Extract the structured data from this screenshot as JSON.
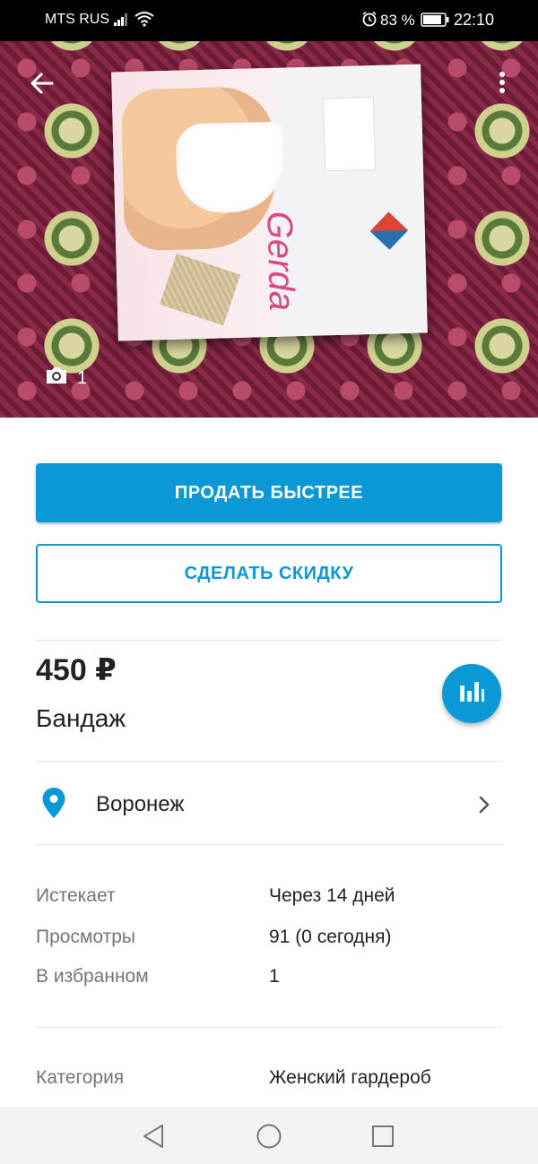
{
  "status_bar": {
    "carrier": "MTS RUS",
    "battery_percent": "83 %",
    "time": "22:10"
  },
  "photo": {
    "count": "1",
    "box_brand_text": "Gerda"
  },
  "actions": {
    "sell_faster": "ПРОДАТЬ БЫСТРЕЕ",
    "make_discount": "СДЕЛАТЬ СКИДКУ"
  },
  "listing": {
    "price": "450 ₽",
    "title": "Бандаж",
    "location": "Воронеж"
  },
  "info": {
    "rows": [
      {
        "label": "Истекает",
        "value": "Через 14 дней"
      },
      {
        "label": "Просмотры",
        "value": "91 (0 сегодня)"
      },
      {
        "label": "В избранном",
        "value": "1"
      }
    ],
    "category_label": "Категория",
    "category_value": "Женский гардероб"
  },
  "colors": {
    "accent": "#0a99d6",
    "status_bar": "#000000",
    "nav_bar": "#f2f2f2"
  },
  "icons": {
    "back": "arrow-left-icon",
    "more": "more-vertical-icon",
    "camera": "camera-icon",
    "stats": "bar-chart-icon",
    "location": "location-pin-icon",
    "chevron": "chevron-right-icon"
  }
}
